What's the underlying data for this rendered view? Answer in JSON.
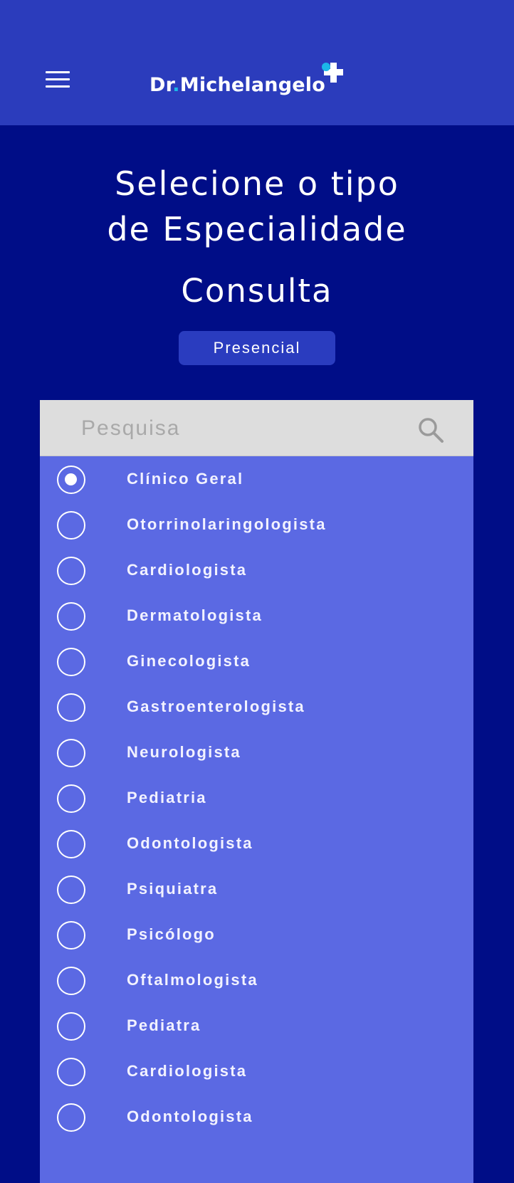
{
  "header": {
    "brand_prefix": "Dr",
    "brand_dot": ".",
    "brand_name": "Michelangelo",
    "menu_icon": "hamburger-menu-icon",
    "brand_accent_color": "#1bb8e8",
    "background_color": "#2b3cbc"
  },
  "page": {
    "title_line1": "Selecione o tipo",
    "title_line2": "de Especialidade",
    "subtitle": "Consulta",
    "mode_label": "Presencial",
    "background_color": "#000d87"
  },
  "search": {
    "placeholder": "Pesquisa",
    "value": "",
    "icon": "search-icon"
  },
  "specialties": {
    "selected_index": 0,
    "items": [
      {
        "label": "Clínico Geral"
      },
      {
        "label": "Otorrinolaringologista"
      },
      {
        "label": "Cardiologista"
      },
      {
        "label": "Dermatologista"
      },
      {
        "label": "Ginecologista"
      },
      {
        "label": "Gastroenterologista"
      },
      {
        "label": "Neurologista"
      },
      {
        "label": "Pediatria"
      },
      {
        "label": "Odontologista"
      },
      {
        "label": "Psiquiatra"
      },
      {
        "label": "Psicólogo"
      },
      {
        "label": "Oftalmologista"
      },
      {
        "label": "Pediatra"
      },
      {
        "label": "Cardiologista"
      },
      {
        "label": "Odontologista"
      }
    ]
  }
}
